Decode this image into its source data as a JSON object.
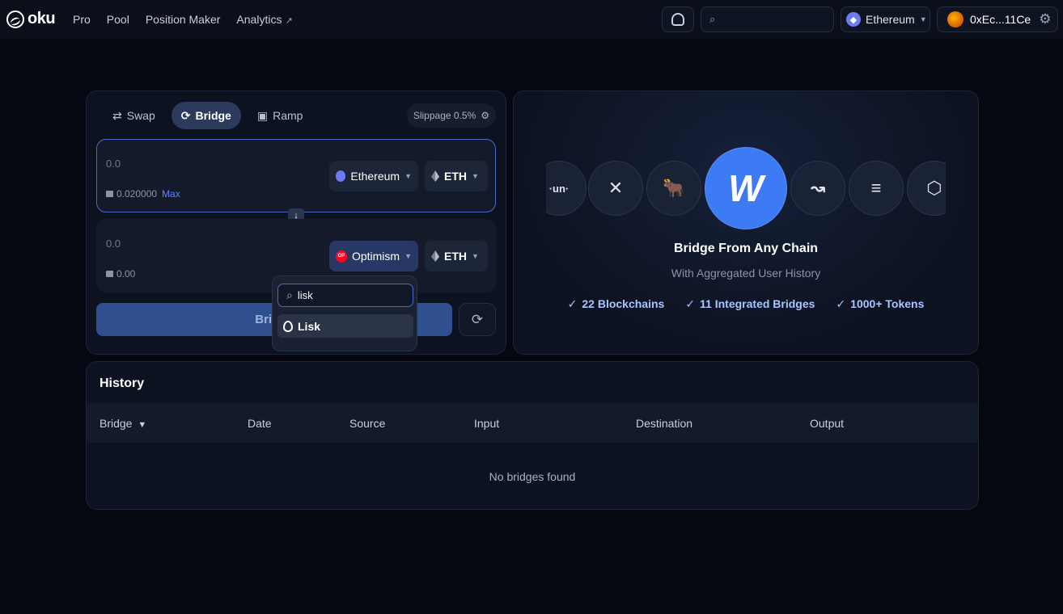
{
  "brand": {
    "name": "oku"
  },
  "nav": {
    "pro": "Pro",
    "pool": "Pool",
    "position_maker": "Position Maker",
    "analytics": "Analytics"
  },
  "header": {
    "search_placeholder": "",
    "chain": "Ethereum",
    "wallet": "0xEc...11Ce"
  },
  "swap": {
    "tabs": [
      {
        "label": "Swap"
      },
      {
        "label": "Bridge"
      },
      {
        "label": "Ramp"
      }
    ],
    "slippage": "Slippage 0.5%",
    "from": {
      "amount": "0.0",
      "balance": "0.020000",
      "max": "Max",
      "chain": "Ethereum",
      "token": "ETH"
    },
    "to": {
      "amount": "0.0",
      "balance": "0.00",
      "chain": "Optimism",
      "token": "ETH"
    },
    "bridge_button": "Bridge"
  },
  "dropdown": {
    "search_value": "lisk",
    "items": [
      {
        "label": "Lisk"
      }
    ]
  },
  "promo": {
    "title": "Bridge From Any Chain",
    "subtitle": "With Aggregated User History",
    "features": [
      "22 Blockchains",
      "11 Integrated Bridges",
      "1000+ Tokens"
    ],
    "coins": [
      "·un·",
      "✕",
      "🐂",
      "W",
      "↝",
      "≡",
      "⬡"
    ]
  },
  "history": {
    "title": "History",
    "columns": [
      "Bridge",
      "Date",
      "Source",
      "Input",
      "Destination",
      "Output"
    ],
    "empty": "No bridges found"
  },
  "colors": {
    "accent": "#3d7bf5",
    "background": "#050810",
    "card": "#0d1220"
  }
}
